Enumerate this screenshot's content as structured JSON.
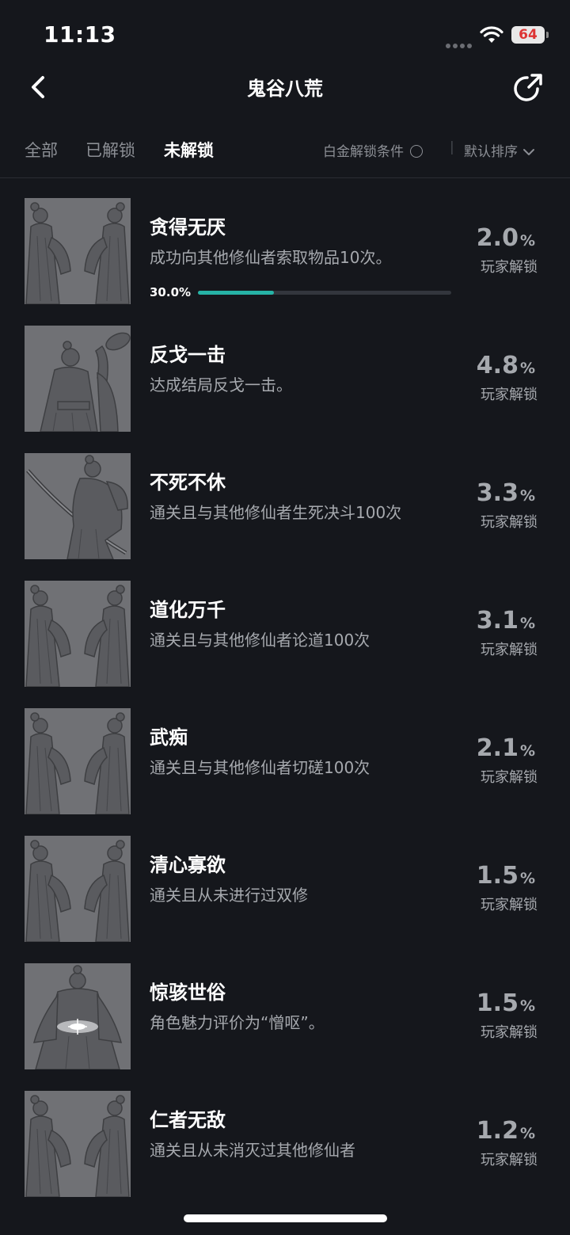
{
  "status_bar": {
    "time": "11:13",
    "battery": "64"
  },
  "header": {
    "title": "鬼谷八荒"
  },
  "tabs": [
    {
      "label": "全部",
      "active": false
    },
    {
      "label": "已解锁",
      "active": false
    },
    {
      "label": "未解锁",
      "active": true
    }
  ],
  "filter": {
    "label": "白金解锁条件",
    "checked": false
  },
  "sort": {
    "label": "默认排序"
  },
  "unit_label": "玩家解锁",
  "accent_color": "#26b3a6",
  "achievements": [
    {
      "name": "贪得无厌",
      "desc": "成功向其他修仙者索取物品10次。",
      "percent": "2.0",
      "image": "twin-figures",
      "progress_text": "30.0%",
      "progress": 0.3
    },
    {
      "name": "反戈一击",
      "desc": "达成结局反戈一击。",
      "percent": "4.8",
      "image": "raised-arm-figure"
    },
    {
      "name": "不死不休",
      "desc": "通关且与其他修仙者生死决斗100次",
      "percent": "3.3",
      "image": "sword-figure"
    },
    {
      "name": "道化万千",
      "desc": "通关且与其他修仙者论道100次",
      "percent": "3.1",
      "image": "twin-figures"
    },
    {
      "name": "武痴",
      "desc": "通关且与其他修仙者切磋100次",
      "percent": "2.1",
      "image": "twin-figures"
    },
    {
      "name": "清心寡欲",
      "desc": "通关且从未进行过双修",
      "percent": "1.5",
      "image": "twin-figures"
    },
    {
      "name": "惊骇世俗",
      "desc": "角色魅力评价为“憎呕”。",
      "percent": "1.5",
      "image": "glowing-figure"
    },
    {
      "name": "仁者无敌",
      "desc": "通关且从未消灭过其他修仙者",
      "percent": "1.2",
      "image": "twin-figures"
    }
  ]
}
